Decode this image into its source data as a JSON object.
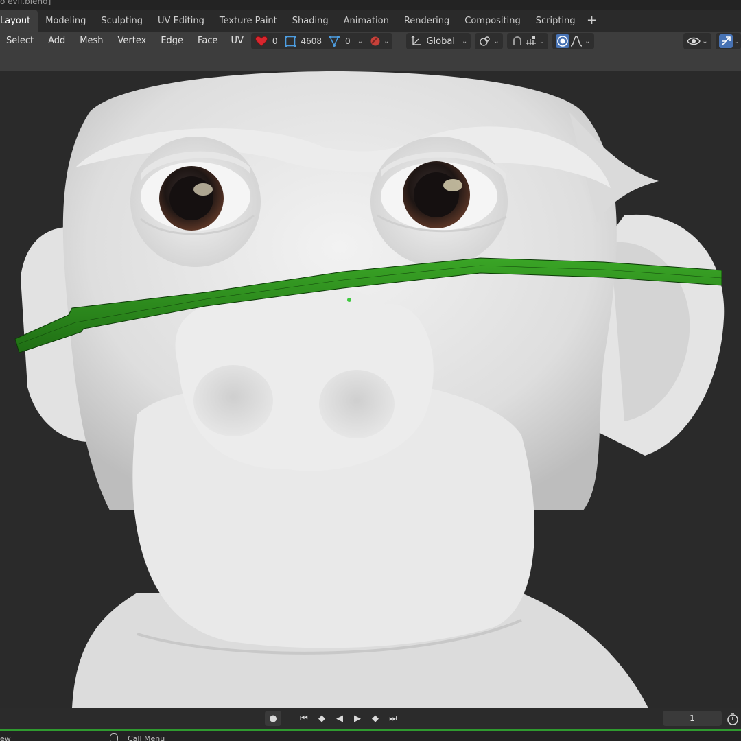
{
  "window": {
    "title": "o evil.blend]"
  },
  "workspace_tabs": [
    {
      "label": "Layout",
      "active": true
    },
    {
      "label": "Modeling",
      "active": false
    },
    {
      "label": "Sculpting",
      "active": false
    },
    {
      "label": "UV Editing",
      "active": false
    },
    {
      "label": "Texture Paint",
      "active": false
    },
    {
      "label": "Shading",
      "active": false
    },
    {
      "label": "Animation",
      "active": false
    },
    {
      "label": "Rendering",
      "active": false
    },
    {
      "label": "Compositing",
      "active": false
    },
    {
      "label": "Scripting",
      "active": false
    }
  ],
  "add_workspace_label": "+",
  "header": {
    "menus": [
      "Select",
      "Add",
      "Mesh",
      "Vertex",
      "Edge",
      "Face",
      "UV"
    ],
    "stats": {
      "favorites": "0",
      "faces": "4608",
      "vertices": "0"
    },
    "transform_orientation": "Global",
    "icons": [
      "heart-icon",
      "face-select-icon",
      "vertex-select-icon",
      "material-icon",
      "orientation-icon",
      "pivot-icon",
      "snap-icon",
      "snap-increment-icon",
      "proportional-edit-icon",
      "falloff-icon",
      "visibility-icon",
      "gizmo-icon"
    ],
    "colors": {
      "accent": "#4772b3",
      "header_bg": "#3d3d3d"
    }
  },
  "viewport": {
    "background": "#2a2a2a",
    "model_color": "#e8e8e8",
    "band_color": "#2d8a1f",
    "selection_dot_color": "#3fc93f"
  },
  "timeline": {
    "current_frame": "1",
    "controls": [
      "record-icon",
      "jump-start-icon",
      "prev-keyframe-icon",
      "play-reverse-icon",
      "play-icon",
      "next-keyframe-icon",
      "jump-end-icon"
    ]
  },
  "statusbar": {
    "left_text": "ew",
    "call_menu": "Call Menu"
  }
}
